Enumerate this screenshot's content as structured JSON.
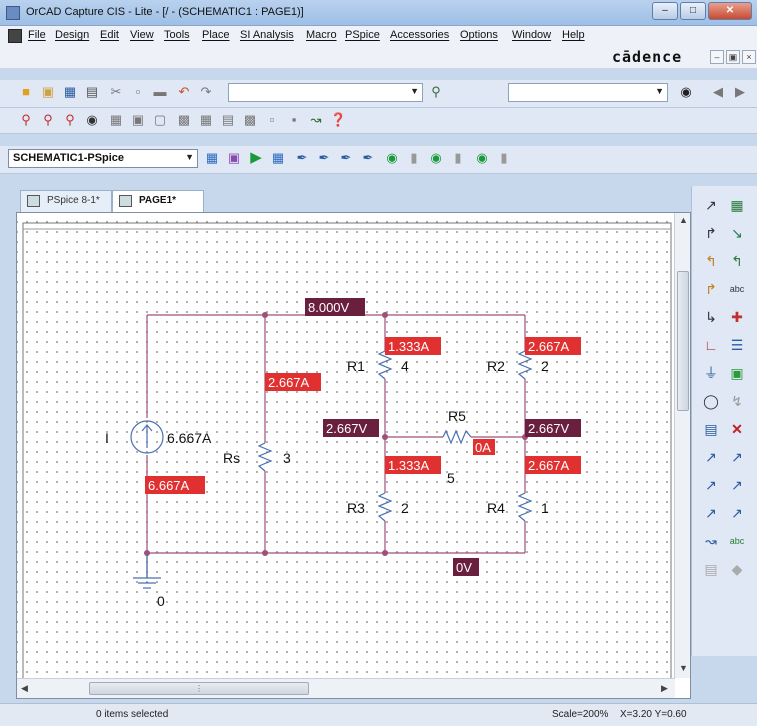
{
  "window": {
    "title": "OrCAD Capture CIS - Lite - [/ - (SCHEMATIC1 : PAGE1)]"
  },
  "menu": [
    "File",
    "Design",
    "Edit",
    "View",
    "Tools",
    "Place",
    "SI Analysis",
    "Macro",
    "PSpice",
    "Accessories",
    "Options",
    "Window",
    "Help"
  ],
  "brand": "cādence",
  "toolbar": {
    "profile_combo": "SCHEMATIC1-PSpice",
    "part_combo": "",
    "search_combo": ""
  },
  "tabs": [
    {
      "label": "PSpice 8-1*",
      "active": false
    },
    {
      "label": "PAGE1*",
      "active": true
    }
  ],
  "schematic": {
    "source": {
      "name": "I",
      "current": "6.667A",
      "branch_current": "6.667A"
    },
    "resistors": [
      {
        "ref": "Rs",
        "value": "3",
        "current": "2.667A"
      },
      {
        "ref": "R1",
        "value": "4",
        "current": "1.333A"
      },
      {
        "ref": "R2",
        "value": "2",
        "current": "2.667A"
      },
      {
        "ref": "R3",
        "value": "2",
        "current": "1.333A"
      },
      {
        "ref": "R4",
        "value": "1",
        "current": "2.667A"
      },
      {
        "ref": "R5",
        "value": "5",
        "current": "0A"
      }
    ],
    "node_voltages": {
      "top": "8.000V",
      "mid_left": "2.667V",
      "mid_right": "2.667V",
      "bottom": "0V"
    },
    "ground_label": "0"
  },
  "status": {
    "selection": "0 items selected",
    "scale": "Scale=200%",
    "coords": "X=3.20  Y=0.60"
  },
  "colors": {
    "wire": "#a04f78",
    "current_badge": "#e03030",
    "voltage_badge": "#6b1f3f",
    "part": "#4a6fb0"
  },
  "icons": [
    "new-icon",
    "open-icon",
    "save-icon",
    "print-icon",
    "cut-icon",
    "copy-icon",
    "paste-icon",
    "undo-icon",
    "redo-icon",
    "zoom-in-icon",
    "zoom-out-icon",
    "search-icon",
    "select-icon",
    "wire-icon",
    "ground-icon",
    "run-icon"
  ]
}
